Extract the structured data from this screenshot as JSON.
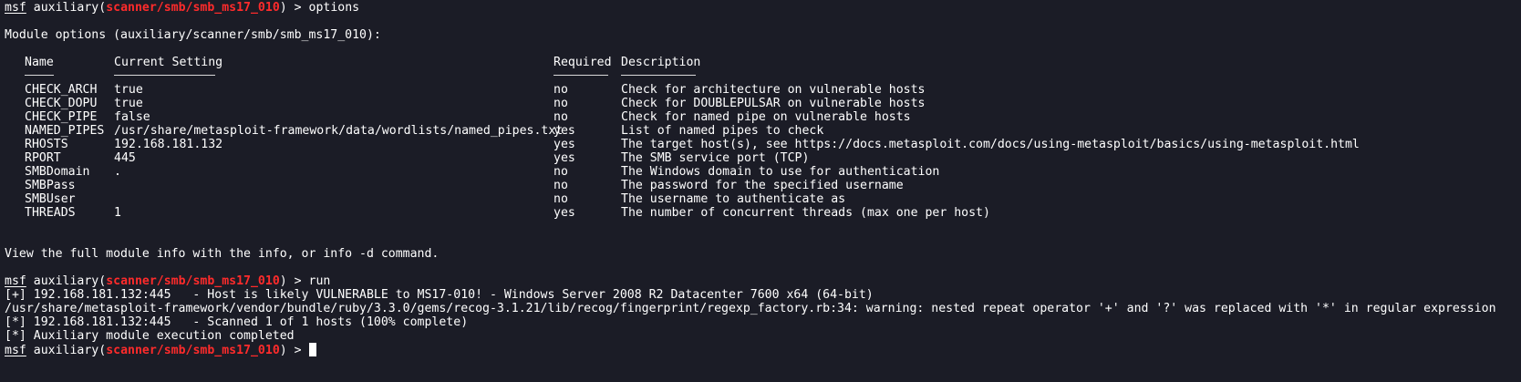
{
  "prompt": {
    "msf": "msf",
    "module_word": "auxiliary",
    "open_paren": "(",
    "module_path": "scanner/smb/smb_ms17_010",
    "close": ") > "
  },
  "commands": {
    "first": "options",
    "second": "run"
  },
  "options_heading": "Module options (auxiliary/scanner/smb/smb_ms17_010):",
  "table": {
    "headers": {
      "name": "Name",
      "current_setting": "Current Setting",
      "required": "Required",
      "description": "Description"
    },
    "rows": [
      {
        "name": "CHECK_ARCH",
        "setting": "true",
        "required": "no",
        "description": "Check for architecture on vulnerable hosts"
      },
      {
        "name": "CHECK_DOPU",
        "setting": "true",
        "required": "no",
        "description": "Check for DOUBLEPULSAR on vulnerable hosts"
      },
      {
        "name": "CHECK_PIPE",
        "setting": "false",
        "required": "no",
        "description": "Check for named pipe on vulnerable hosts"
      },
      {
        "name": "NAMED_PIPES",
        "setting": "/usr/share/metasploit-framework/data/wordlists/named_pipes.txt",
        "required": "yes",
        "description": "List of named pipes to check"
      },
      {
        "name": "RHOSTS",
        "setting": "192.168.181.132",
        "required": "yes",
        "description": "The target host(s), see https://docs.metasploit.com/docs/using-metasploit/basics/using-metasploit.html"
      },
      {
        "name": "RPORT",
        "setting": "445",
        "required": "yes",
        "description": "The SMB service port (TCP)"
      },
      {
        "name": "SMBDomain",
        "setting": ".",
        "required": "no",
        "description": "The Windows domain to use for authentication"
      },
      {
        "name": "SMBPass",
        "setting": "",
        "required": "no",
        "description": "The password for the specified username"
      },
      {
        "name": "SMBUser",
        "setting": "",
        "required": "no",
        "description": "The username to authenticate as"
      },
      {
        "name": "THREADS",
        "setting": "1",
        "required": "yes",
        "description": "The number of concurrent threads (max one per host)"
      }
    ]
  },
  "info_hint": "View the full module info with the info, or info -d command.",
  "output_lines": [
    "[+] 192.168.181.132:445   - Host is likely VULNERABLE to MS17-010! - Windows Server 2008 R2 Datacenter 7600 x64 (64-bit)",
    "/usr/share/metasploit-framework/vendor/bundle/ruby/3.3.0/gems/recog-3.1.21/lib/recog/fingerprint/regexp_factory.rb:34: warning: nested repeat operator '+' and '?' was replaced with '*' in regular expression",
    "[*] 192.168.181.132:445   - Scanned 1 of 1 hosts (100% complete)",
    "[*] Auxiliary module execution completed"
  ],
  "colors": {
    "background": "#1b1c26",
    "text": "#ffffff",
    "module_path": "#ff2b2b"
  }
}
